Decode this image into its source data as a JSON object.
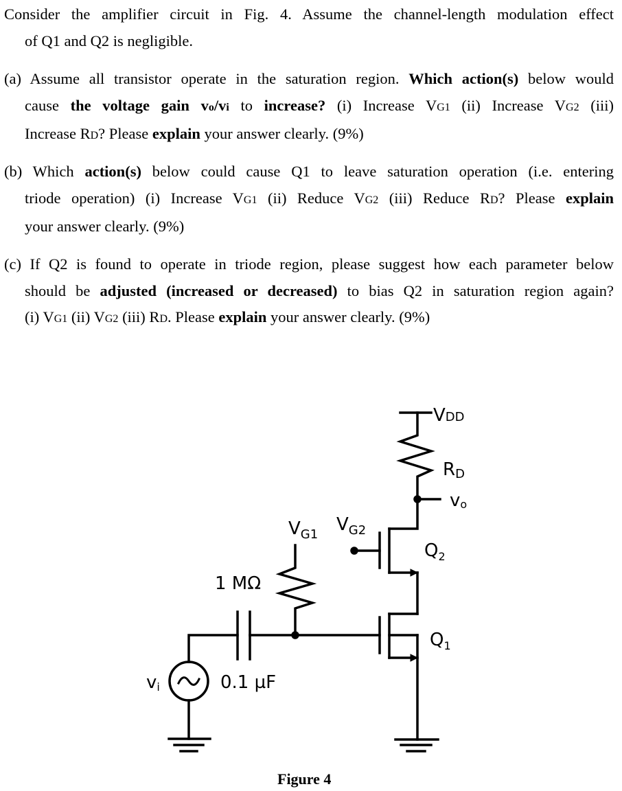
{
  "paragraphs": [
    {
      "lines": [
        [
          {
            "t": "Consider the amplifier circuit in Fig. 4. Assume the channel-length modulation effect"
          }
        ],
        [
          {
            "t": "of Q1 and Q2 is negligible."
          }
        ]
      ]
    },
    {
      "lines": [
        [
          {
            "t": "(a) Assume all transistor operate in the saturation region. "
          },
          {
            "t": "Which action(s)",
            "b": 1
          },
          {
            "t": " below would"
          }
        ],
        [
          {
            "t": "cause "
          },
          {
            "t": "the voltage gain v",
            "b": 1
          },
          {
            "t": "o",
            "b": 1,
            "s": 1
          },
          {
            "t": "/v",
            "b": 1
          },
          {
            "t": "i",
            "b": 1,
            "s": 1
          },
          {
            "t": " to "
          },
          {
            "t": "increase?",
            "b": 1
          },
          {
            "t": " (i) Increase V"
          },
          {
            "t": "G1",
            "s": 1
          },
          {
            "t": " (ii) Increase V"
          },
          {
            "t": "G2",
            "s": 1
          },
          {
            "t": " (iii)"
          }
        ],
        [
          {
            "t": "Increase R"
          },
          {
            "t": "D",
            "s": 1
          },
          {
            "t": "?    Please "
          },
          {
            "t": "explain",
            "b": 1
          },
          {
            "t": " your answer clearly. (9%)"
          }
        ]
      ]
    },
    {
      "lines": [
        [
          {
            "t": "(b) Which "
          },
          {
            "t": "action(s)",
            "b": 1
          },
          {
            "t": " below could cause Q1 to leave saturation operation (i.e. entering"
          }
        ],
        [
          {
            "t": "triode operation) (i) Increase V"
          },
          {
            "t": "G1",
            "s": 1
          },
          {
            "t": " (ii) Reduce V"
          },
          {
            "t": "G2",
            "s": 1
          },
          {
            "t": " (iii) Reduce R"
          },
          {
            "t": "D",
            "s": 1
          },
          {
            "t": "? Please "
          },
          {
            "t": "explain",
            "b": 1
          }
        ],
        [
          {
            "t": "your answer clearly. (9%)"
          }
        ]
      ]
    },
    {
      "lines": [
        [
          {
            "t": "(c) If Q2 is found to operate in triode region, please suggest how each parameter below"
          }
        ],
        [
          {
            "t": "should be "
          },
          {
            "t": "adjusted (increased or decreased)",
            "b": 1
          },
          {
            "t": " to bias Q2 in saturation region again?"
          }
        ],
        [
          {
            "t": "(i) V"
          },
          {
            "t": "G1",
            "s": 1
          },
          {
            "t": " (ii) V"
          },
          {
            "t": "G2",
            "s": 1
          },
          {
            "t": " (iii) R"
          },
          {
            "t": "D",
            "s": 1
          },
          {
            "t": ". Please "
          },
          {
            "t": "explain",
            "b": 1
          },
          {
            "t": " your answer clearly. (9%)"
          }
        ]
      ]
    }
  ],
  "figure": {
    "caption": "Figure 4",
    "labels": {
      "vdd": "V",
      "vdd_sub": "DD",
      "rd": "R",
      "rd_sub": "D",
      "vo": "v",
      "vo_sub": "o",
      "vg1": "V",
      "vg1_sub": "G1",
      "vg2": "V",
      "vg2_sub": "G2",
      "q2": "Q",
      "q2_sub": "2",
      "q1": "Q",
      "q1_sub": "1",
      "r1": "1 MΩ",
      "c1": "0.1 µF",
      "vi": "v",
      "vi_sub": "i"
    },
    "colors": {
      "wire": "#000000",
      "text": "#000000"
    }
  }
}
